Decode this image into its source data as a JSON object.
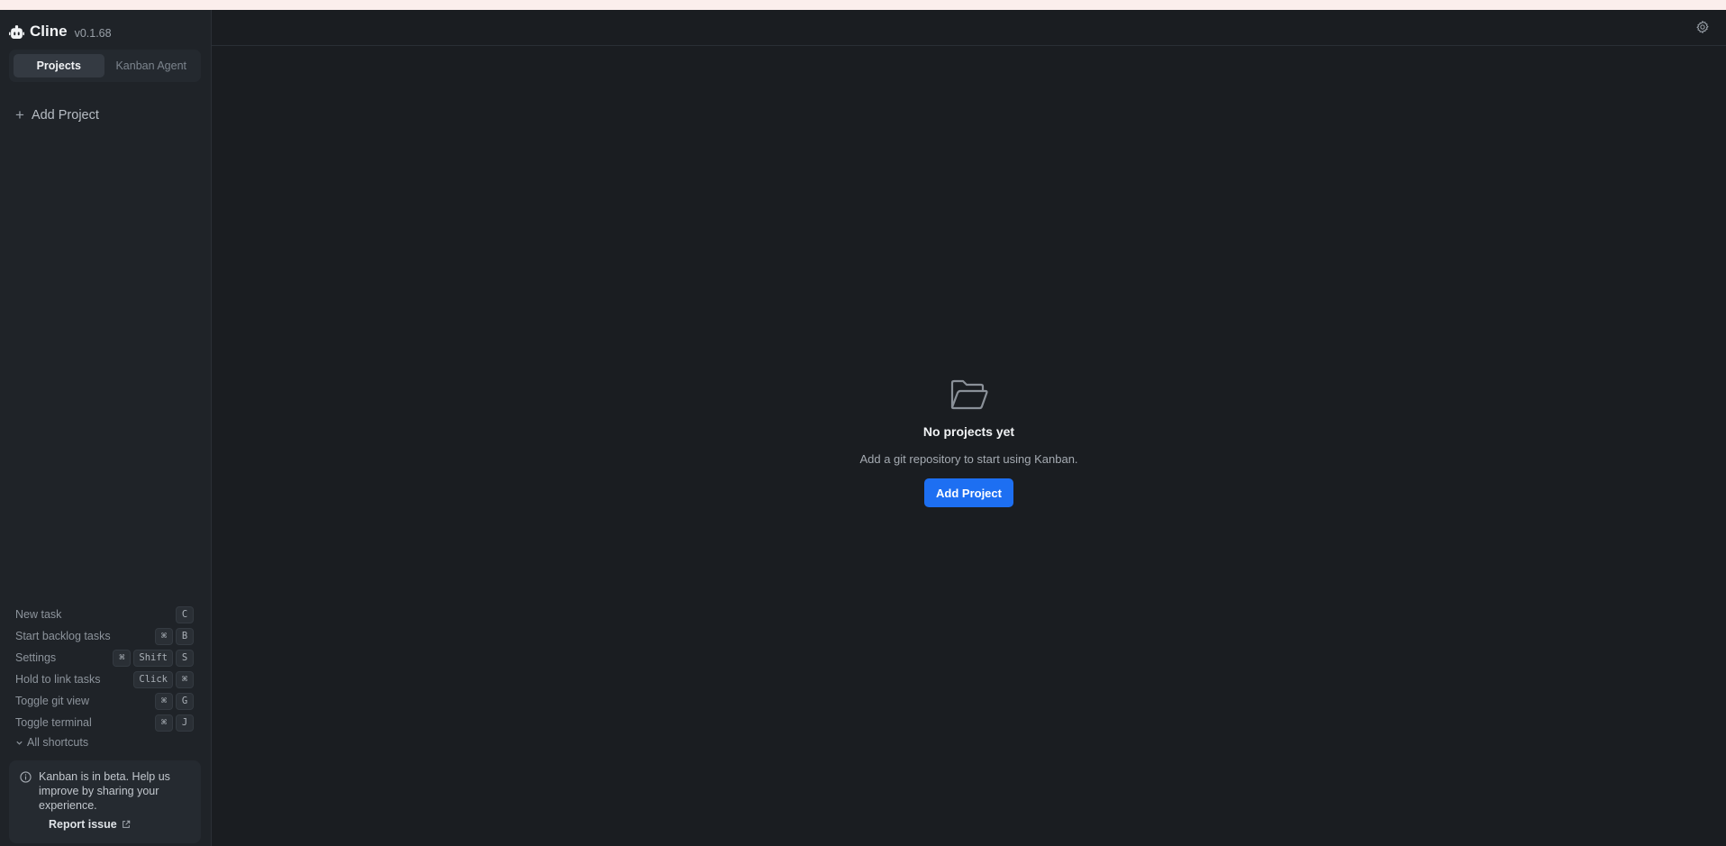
{
  "app": {
    "name": "Cline",
    "version": "v0.1.68"
  },
  "sidebar": {
    "tabs": [
      {
        "label": "Projects",
        "active": true
      },
      {
        "label": "Kanban Agent",
        "active": false
      }
    ],
    "add_project_label": "Add Project",
    "shortcuts": [
      {
        "label": "New task",
        "keys": [
          "C"
        ]
      },
      {
        "label": "Start backlog tasks",
        "keys": [
          "⌘",
          "B"
        ]
      },
      {
        "label": "Settings",
        "keys": [
          "⌘",
          "Shift",
          "S"
        ]
      },
      {
        "label": "Hold to link tasks",
        "keys": [
          "Click",
          "⌘"
        ]
      },
      {
        "label": "Toggle git view",
        "keys": [
          "⌘",
          "G"
        ]
      },
      {
        "label": "Toggle terminal",
        "keys": [
          "⌘",
          "J"
        ]
      }
    ],
    "all_shortcuts_label": "All shortcuts",
    "beta_notice": {
      "text": "Kanban is in beta. Help us improve by sharing your experience.",
      "link_label": "Report issue"
    }
  },
  "main": {
    "empty_state": {
      "icon": "folder-open-icon",
      "title": "No projects yet",
      "subtitle": "Add a git repository to start using Kanban.",
      "button_label": "Add Project"
    },
    "settings_icon": "gear-icon"
  },
  "colors": {
    "accent": "#1d6ff2",
    "background": "#1a1d21",
    "sidebar_bg": "#1f2328"
  }
}
